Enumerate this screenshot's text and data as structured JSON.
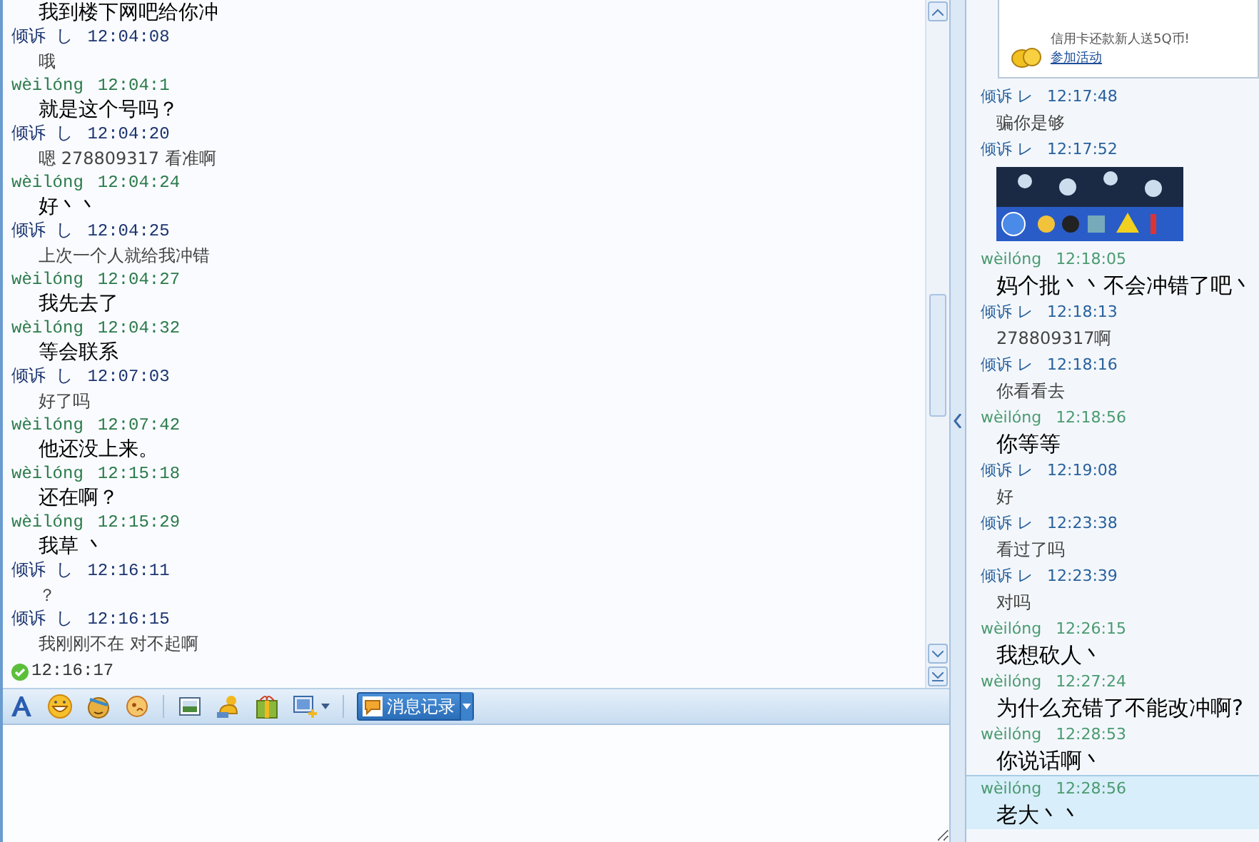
{
  "history": {
    "messages": [
      {
        "kind": "own",
        "text": "我到楼下网吧给你冲"
      },
      {
        "kind": "peer",
        "sender": "倾诉 し",
        "time": "12:04:08",
        "text": "哦"
      },
      {
        "kind": "own",
        "sender": "wèilóng",
        "time": "12:04:1",
        "text": "就是这个号吗？"
      },
      {
        "kind": "peer",
        "sender": "倾诉 し",
        "time": "12:04:20",
        "text": "嗯  278809317  看准啊"
      },
      {
        "kind": "own",
        "sender": "wèilóng",
        "time": "12:04:24",
        "text": "好丶丶"
      },
      {
        "kind": "peer",
        "sender": "倾诉 し",
        "time": "12:04:25",
        "text": "上次一个人就给我冲错"
      },
      {
        "kind": "own",
        "sender": "wèilóng",
        "time": "12:04:27",
        "text": "我先去了"
      },
      {
        "kind": "own",
        "sender": "wèilóng",
        "time": "12:04:32",
        "text": "等会联系"
      },
      {
        "kind": "peer",
        "sender": "倾诉 し",
        "time": "12:07:03",
        "text": "好了吗"
      },
      {
        "kind": "own",
        "sender": "wèilóng",
        "time": "12:07:42",
        "text": "他还没上来。"
      },
      {
        "kind": "own",
        "sender": "wèilóng",
        "time": "12:15:18",
        "text": "还在啊？"
      },
      {
        "kind": "own",
        "sender": "wèilóng",
        "time": "12:15:29",
        "text": "我草 丶"
      },
      {
        "kind": "peer",
        "sender": "倾诉 し",
        "time": "12:16:11",
        "text": "？"
      },
      {
        "kind": "peer",
        "sender": "倾诉 し",
        "time": "12:16:15",
        "text": "我刚刚不在   对不起啊"
      }
    ],
    "status_time": "12:16:17"
  },
  "toolbar": {
    "history_button": "消息记录"
  },
  "side_panel": {
    "ad": {
      "text": "信用卡还款新人送5Q币!",
      "link": "参加活动"
    },
    "messages": [
      {
        "kind": "peer",
        "sender": "倾诉 レ",
        "time": "12:17:48",
        "text": "骗你是够",
        "selected": false
      },
      {
        "kind": "image",
        "sender": "倾诉 レ",
        "time": "12:17:52",
        "selected": false
      },
      {
        "kind": "own",
        "sender": "wèilóng",
        "time": "12:18:05",
        "text": "妈个批丶丶不会冲错了吧丶",
        "selected": false
      },
      {
        "kind": "peer",
        "sender": "倾诉 レ",
        "time": "12:18:13",
        "text": "278809317啊",
        "selected": false
      },
      {
        "kind": "peer",
        "sender": "倾诉 レ",
        "time": "12:18:16",
        "text": "你看看去",
        "selected": false
      },
      {
        "kind": "own",
        "sender": "wèilóng",
        "time": "12:18:56",
        "text": "你等等",
        "selected": false
      },
      {
        "kind": "peer",
        "sender": "倾诉 レ",
        "time": "12:19:08",
        "text": "好",
        "selected": false
      },
      {
        "kind": "peer",
        "sender": "倾诉 レ",
        "time": "12:23:38",
        "text": "看过了吗",
        "selected": false
      },
      {
        "kind": "peer",
        "sender": "倾诉 レ",
        "time": "12:23:39",
        "text": "对吗",
        "selected": false
      },
      {
        "kind": "own",
        "sender": "wèilóng",
        "time": "12:26:15",
        "text": "我想砍人丶",
        "selected": false
      },
      {
        "kind": "own",
        "sender": "wèilóng",
        "time": "12:27:24",
        "text": "为什么充错了不能改冲啊?",
        "selected": false
      },
      {
        "kind": "own",
        "sender": "wèilóng",
        "time": "12:28:53",
        "text": "你说话啊丶",
        "selected": false
      },
      {
        "kind": "own",
        "sender": "wèilóng",
        "time": "12:28:56",
        "text": "老大丶丶",
        "selected": true
      }
    ]
  }
}
